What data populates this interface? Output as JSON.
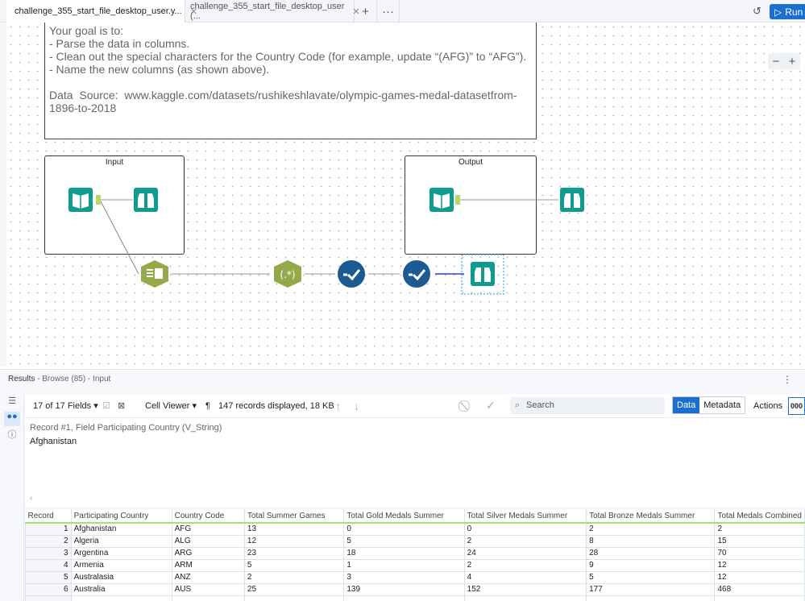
{
  "tabs": [
    {
      "label": "challenge_355_start_file_desktop_user.y...",
      "active": true
    },
    {
      "label": "challenge_355_start_file_desktop_user (..."
    }
  ],
  "toolbar": {
    "add": "+",
    "more": "···",
    "history_icon": "history-icon",
    "run_label": "Run"
  },
  "canvas": {
    "zoom_out": "−",
    "zoom_in": "+",
    "note_lines": [
      "Your goal is to:",
      "- Parse the data in columns.",
      "- Clean out the special characters for the Country Code (for example, update “(AFG)” to “AFG”).",
      "- Name the new columns (as shown above).",
      "",
      "Data  Source:  www.kaggle.com/datasets/rushikeshlavate/olympic-games-medal-datasetfrom-",
      "1896-to-2018"
    ],
    "containers": {
      "input": "Input",
      "output": "Output"
    },
    "colors": {
      "teal": "#0f9b8e",
      "olive": "#96a94a",
      "navy": "#1c5a94",
      "connector": "#b7d66b"
    }
  },
  "results": {
    "title": "Results",
    "subtitle": "- Browse (85) - Input",
    "fields": "17 of 17 Fields",
    "viewer": "Cell Viewer",
    "records": "147 records displayed, 18 KB",
    "search_placeholder": "Search",
    "data_tab": "Data",
    "metadata_tab": "Metadata",
    "actions": "Actions",
    "more": "000",
    "record_label": "Record #1, Field Participating Country (V_String)",
    "record_value": "Afghanistan",
    "columns": [
      "Record",
      "Participating Country",
      "Country Code",
      "Total Summer Games",
      "Total Gold Medals Summer",
      "Total Silver Medals Summer",
      "Total Bronze Medals Summer",
      "Total Medals Combined"
    ],
    "rows": [
      [
        "1",
        "Afghanistan",
        "AFG",
        "13",
        "0",
        "0",
        "2",
        "2"
      ],
      [
        "2",
        "Algeria",
        "ALG",
        "12",
        "5",
        "2",
        "8",
        "15"
      ],
      [
        "3",
        "Argentina",
        "ARG",
        "23",
        "18",
        "24",
        "28",
        "70"
      ],
      [
        "4",
        "Armenia",
        "ARM",
        "5",
        "1",
        "2",
        "9",
        "12"
      ],
      [
        "5",
        "Australasia",
        "ANZ",
        "2",
        "3",
        "4",
        "5",
        "12"
      ],
      [
        "6",
        "Australia",
        "AUS",
        "25",
        "139",
        "152",
        "177",
        "468"
      ]
    ]
  }
}
